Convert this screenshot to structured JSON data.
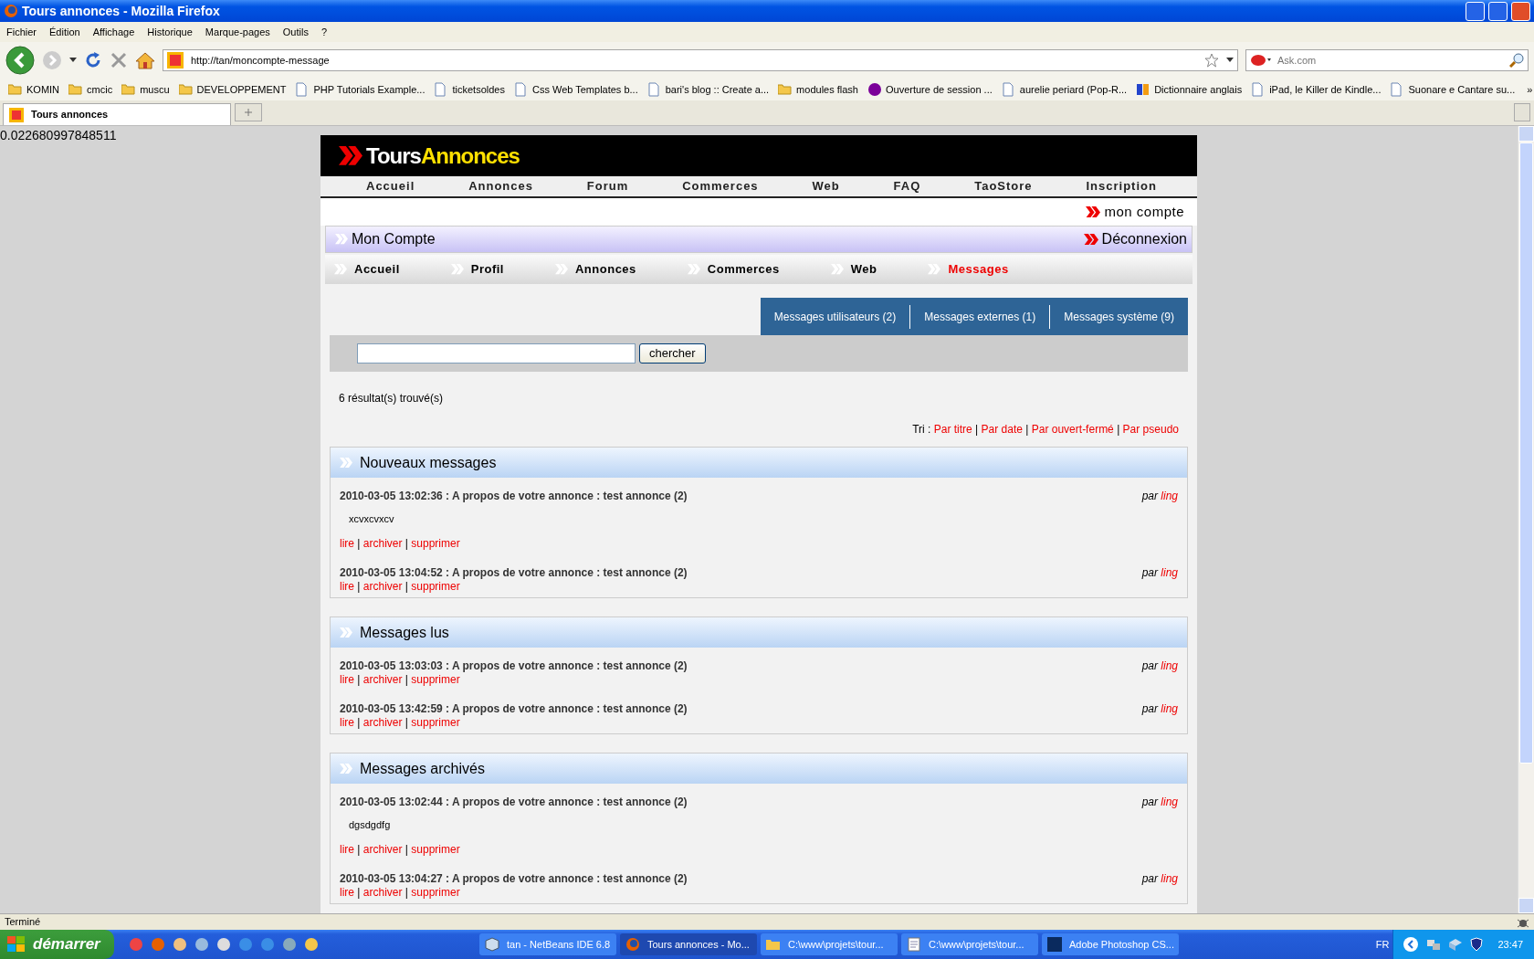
{
  "window": {
    "title": "Tours annonces - Mozilla Firefox"
  },
  "menu": [
    "Fichier",
    "Édition",
    "Affichage",
    "Historique",
    "Marque-pages",
    "Outils",
    "?"
  ],
  "address": "http://tan/moncompte-message",
  "web_search": {
    "placeholder": "Ask.com"
  },
  "bookmarks": [
    {
      "kind": "folder",
      "label": "KOMIN"
    },
    {
      "kind": "folder",
      "label": "cmcic"
    },
    {
      "kind": "folder",
      "label": "muscu"
    },
    {
      "kind": "folder",
      "label": "DEVELOPPEMENT"
    },
    {
      "kind": "page",
      "label": "PHP Tutorials Example..."
    },
    {
      "kind": "page",
      "label": "ticketsoldes"
    },
    {
      "kind": "page",
      "label": "Css Web Templates b..."
    },
    {
      "kind": "page",
      "label": "bari's blog :: Create a..."
    },
    {
      "kind": "folder",
      "label": "modules flash"
    },
    {
      "kind": "yahoo",
      "label": "Ouverture de session ..."
    },
    {
      "kind": "page",
      "label": "aurelie periard (Pop-R..."
    },
    {
      "kind": "wr",
      "label": "Dictionnaire anglais"
    },
    {
      "kind": "page",
      "label": "iPad, le Killer de Kindle..."
    },
    {
      "kind": "page",
      "label": "Suonare e Cantare su..."
    }
  ],
  "bookmarks_overflow": "»",
  "tabs": [
    {
      "label": "Tours annonces",
      "selected": true
    }
  ],
  "page_output": "0.022680997848511",
  "site": {
    "logo": {
      "first": "Tours",
      "second": "Annonces"
    },
    "nav": [
      "Accueil",
      "Annonces",
      "Forum",
      "Commerces",
      "Web",
      "FAQ",
      "TaoStore",
      "Inscription"
    ],
    "account_link": "mon compte",
    "account_bar": {
      "title": "Mon Compte",
      "logout": "Déconnexion"
    },
    "subnav": [
      {
        "label": "Accueil",
        "selected": false
      },
      {
        "label": "Profil",
        "selected": false
      },
      {
        "label": "Annonces",
        "selected": false
      },
      {
        "label": "Commerces",
        "selected": false
      },
      {
        "label": "Web",
        "selected": false
      },
      {
        "label": "Messages",
        "selected": true
      }
    ],
    "message_tabs": [
      "Messages utilisateurs (2)",
      "Messages externes (1)",
      "Messages système (9)"
    ],
    "search": {
      "button": "chercher"
    },
    "results": "6 résultat(s) trouvé(s)",
    "separator": "|",
    "sort": {
      "label": "Tri :",
      "options": [
        "Par titre",
        "Par date",
        "Par ouvert-fermé",
        "Par pseudo"
      ]
    },
    "sections": [
      {
        "title": "Nouveaux messages",
        "messages": [
          {
            "title": "2010-03-05 13:02:36 : A propos de votre annonce : test annonce (2)",
            "by": "par",
            "author": "ling",
            "body": "xcvxcvxcv",
            "actions": [
              "lire",
              "archiver",
              "supprimer"
            ]
          },
          {
            "title": "2010-03-05 13:04:52 : A propos de votre annonce : test annonce (2)",
            "by": "par",
            "author": "ling",
            "actions": [
              "lire",
              "archiver",
              "supprimer"
            ]
          }
        ]
      },
      {
        "title": "Messages lus",
        "messages": [
          {
            "title": "2010-03-05 13:03:03 : A propos de votre annonce : test annonce (2)",
            "by": "par",
            "author": "ling",
            "actions": [
              "lire",
              "archiver",
              "supprimer"
            ]
          },
          {
            "title": "2010-03-05 13:42:59 : A propos de votre annonce : test annonce (2)",
            "by": "par",
            "author": "ling",
            "actions": [
              "lire",
              "archiver",
              "supprimer"
            ]
          }
        ]
      },
      {
        "title": "Messages archivés",
        "messages": [
          {
            "title": "2010-03-05 13:02:44 : A propos de votre annonce : test annonce (2)",
            "by": "par",
            "author": "ling",
            "body": "dgsdgdfg",
            "actions": [
              "lire",
              "archiver",
              "supprimer"
            ]
          },
          {
            "title": "2010-03-05 13:04:27 : A propos de votre annonce : test annonce (2)",
            "by": "par",
            "author": "ling",
            "actions": [
              "lire",
              "archiver",
              "supprimer"
            ]
          }
        ]
      }
    ]
  },
  "status_bar": "Terminé",
  "taskbar": {
    "start": "démarrer",
    "tasks": [
      {
        "kind": "cube",
        "label": "tan - NetBeans IDE 6.8",
        "selected": false
      },
      {
        "kind": "firefox",
        "label": "Tours annonces - Mo...",
        "selected": true
      },
      {
        "kind": "folder",
        "label": "C:\\www\\projets\\tour...",
        "selected": false
      },
      {
        "kind": "notes",
        "label": "C:\\www\\projets\\tour...",
        "selected": false
      },
      {
        "kind": "ps",
        "label": "Adobe Photoshop CS...",
        "selected": false
      }
    ],
    "language": "FR",
    "clock": "23:47"
  }
}
